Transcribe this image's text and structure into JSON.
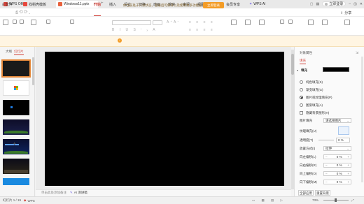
{
  "titlebar": {
    "app_tab": "WPS Office",
    "tab2": "找稻壳模板",
    "doc_tab": "Windows11.pptx",
    "login_label": "立即登录"
  },
  "menu": {
    "file": "文件",
    "items": [
      "开始",
      "插入",
      "设计",
      "切换",
      "动画",
      "放映",
      "审阅",
      "视图",
      "工具",
      "会员专享",
      "WPS AI"
    ],
    "active": "开始",
    "share": "分享"
  },
  "notice": {
    "text": "你当前处于只读状态，登录后可保存以及使用更多功能服务。",
    "button": "立即登录"
  },
  "left_panel": {
    "tab_outline": "大纲",
    "tab_slides": "幻灯片",
    "add_icon": "+",
    "thumbnails": [
      {
        "id": "1",
        "style": "selected"
      },
      {
        "id": "2",
        "style": "white"
      },
      {
        "id": "3",
        "style": "dark"
      },
      {
        "id": "4",
        "style": "dark"
      },
      {
        "id": "5",
        "style": "dark"
      },
      {
        "id": "6",
        "style": "dark"
      },
      {
        "id": "7",
        "style": "dark"
      },
      {
        "id": "8",
        "style": "blue"
      }
    ]
  },
  "canvas": {
    "notes_placeholder": "单击此处添加备注",
    "ai_button": "AI 演讲稿"
  },
  "right_panel": {
    "title": "对象属性",
    "tab": "填充",
    "section": "填充",
    "fill_options": [
      {
        "label": "纯色填充(S)",
        "checked": false
      },
      {
        "label": "渐变填充(G)",
        "checked": false
      },
      {
        "label": "图片或纹理填充(P)",
        "checked": true
      },
      {
        "label": "图案填充(A)",
        "checked": false
      }
    ],
    "hide_bg_label": "隐藏背景图形(H)",
    "picture_fill_label": "图片填充",
    "picture_fill_value": "请选择图片",
    "texture_label": "纹理填充(U)",
    "transparency_label": "透明度(T)",
    "transparency_value": "0",
    "transparency_unit": "%",
    "placement_label": "放置方式(I)",
    "placement_value": "拉伸",
    "offset_left_label": "向左偏移(L)",
    "offset_right_label": "向右偏移(R)",
    "offset_top_label": "向上偏移(O)",
    "offset_bottom_label": "向下偏移(M)",
    "offset_value": "0",
    "offset_unit": "%",
    "apply_all": "全部应用",
    "reset_bg": "重置背景"
  },
  "status": {
    "slide_count": "幻灯片 1 / 19",
    "brand": "WPS",
    "zoom": "73%"
  },
  "colors": {
    "accent": "#d0433a",
    "notice_btn": "#f39c26",
    "selection": "#e68a3c"
  }
}
